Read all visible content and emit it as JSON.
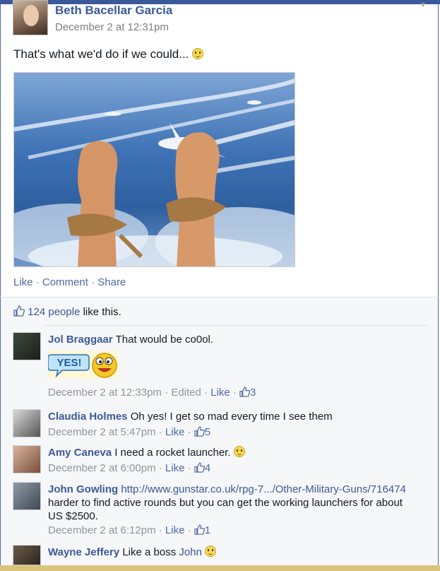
{
  "post": {
    "author": "Beth Bacellar Garcia",
    "timestamp": "December 2 at 12:31pm",
    "text": "That's what we'd do if we could...",
    "actions": {
      "like": "Like",
      "comment": "Comment",
      "share": "Share",
      "sep": "·"
    },
    "likes_count": "124 people",
    "likes_suffix": "like this."
  },
  "comments": [
    {
      "name": "Jol Braggaar",
      "text": "That would be co0ol.",
      "sticker": "YES!",
      "time": "December 2 at 12:33pm",
      "edited": "Edited",
      "like": "Like",
      "likes": "3"
    },
    {
      "name": "Claudia Holmes",
      "text": "Oh yes! I get so mad every time I see them",
      "time": "December 2 at 5:47pm",
      "like": "Like",
      "likes": "5"
    },
    {
      "name": "Amy Caneva",
      "text": "I need a rocket launcher.",
      "time": "December 2 at 6:00pm",
      "like": "Like",
      "likes": "4"
    },
    {
      "name": "John Gowling",
      "link": "http://www.gunstar.co.uk/rpg-7.../Other-Military-Guns/716474",
      "text": "harder to find active rounds but you can get the working launchers for about US $2500.",
      "time": "December 2 at 6:12pm",
      "like": "Like",
      "likes": "1"
    },
    {
      "name": "Wayne Jeffery",
      "text": "Like a boss",
      "mention": "John"
    }
  ],
  "colors": {
    "brand": "#3b5998",
    "link": "#4e69a2",
    "meta": "#90949c",
    "ufi_bg": "#f6f7f9"
  }
}
